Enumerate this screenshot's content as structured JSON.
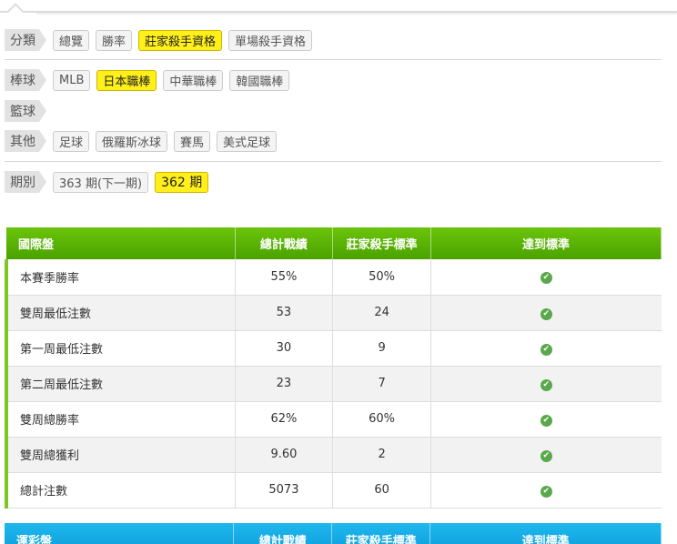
{
  "filters": {
    "category": {
      "label": "分類",
      "chips": [
        "總覽",
        "勝率",
        "莊家殺手資格",
        "單場殺手資格"
      ],
      "active": "莊家殺手資格"
    },
    "baseball": {
      "label": "棒球",
      "chips": [
        "MLB",
        "日本職棒",
        "中華職棒",
        "韓國職棒"
      ],
      "active": "日本職棒"
    },
    "basketball": {
      "label": "籃球",
      "chips": []
    },
    "other": {
      "label": "其他",
      "chips": [
        "足球",
        "俄羅斯冰球",
        "賽馬",
        "美式足球"
      ]
    },
    "period": {
      "label": "期別",
      "chips": [
        "363 期(下一期)",
        "362 期"
      ],
      "active": "362 期"
    }
  },
  "international_table": {
    "headers": [
      "國際盤",
      "總計戰績",
      "莊家殺手標準",
      "達到標準"
    ],
    "rows": [
      {
        "label": "本賽季勝率",
        "total": "55%",
        "standard": "50%",
        "met": true
      },
      {
        "label": "雙周最低注數",
        "total": "53",
        "standard": "24",
        "met": true
      },
      {
        "label": "第一周最低注數",
        "total": "30",
        "standard": "9",
        "met": true
      },
      {
        "label": "第二周最低注數",
        "total": "23",
        "standard": "7",
        "met": true
      },
      {
        "label": "雙周總勝率",
        "total": "62%",
        "standard": "60%",
        "met": true
      },
      {
        "label": "雙周總獲利",
        "total": "9.60",
        "standard": "2",
        "met": true
      },
      {
        "label": "總計注數",
        "total": "5073",
        "standard": "60",
        "met": true
      }
    ],
    "check_icon": "✔",
    "colors": {
      "header": "#5bb306",
      "accent": "#7cc724",
      "check": "#5aa84c"
    }
  },
  "lottery_table": {
    "headers": [
      "運彩盤",
      "總計戰績",
      "莊家殺手標準",
      "達到標準"
    ],
    "colors": {
      "header": "#14a8e4"
    }
  },
  "colors": {
    "active_chip": "#ffef1a"
  }
}
